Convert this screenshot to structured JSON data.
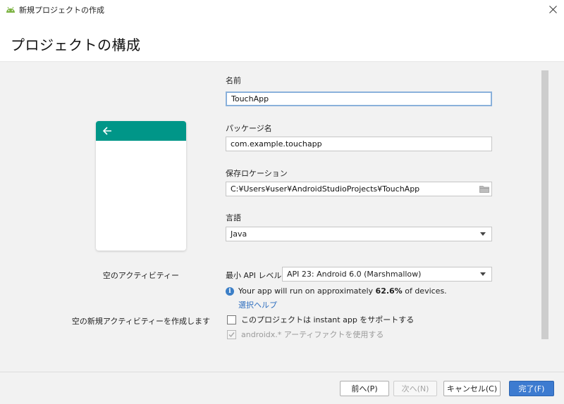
{
  "window": {
    "title": "新規プロジェクトの作成",
    "accent": "#3d7bd0"
  },
  "page": {
    "title": "プロジェクトの構成"
  },
  "template": {
    "name": "空のアクティビティー",
    "description": "空の新規アクティビティーを作成します",
    "appbar_color": "#009688",
    "back_icon": "arrow-left-icon"
  },
  "form": {
    "name_label": "名前",
    "name_value": "TouchApp",
    "package_label": "パッケージ名",
    "package_value": "com.example.touchapp",
    "location_label": "保存ロケーション",
    "location_value": "C:¥Users¥user¥AndroidStudioProjects¥TouchApp",
    "language_label": "言語",
    "language_value": "Java",
    "api_label": "最小 API レベル",
    "api_value": "API 23: Android 6.0 (Marshmallow)",
    "info_prefix": "Your app will run on approximately ",
    "info_percent": "62.6%",
    "info_suffix": " of devices.",
    "help_link": "選択ヘルプ",
    "instant_app_label": "このプロジェクトは instant app をサポートする",
    "instant_app_checked": false,
    "androidx_label": "androidx.* アーティファクトを使用する",
    "androidx_checked": true
  },
  "buttons": {
    "previous": "前へ(P)",
    "next": "次へ(N)",
    "cancel": "キャンセル(C)",
    "finish": "完了(F)"
  }
}
